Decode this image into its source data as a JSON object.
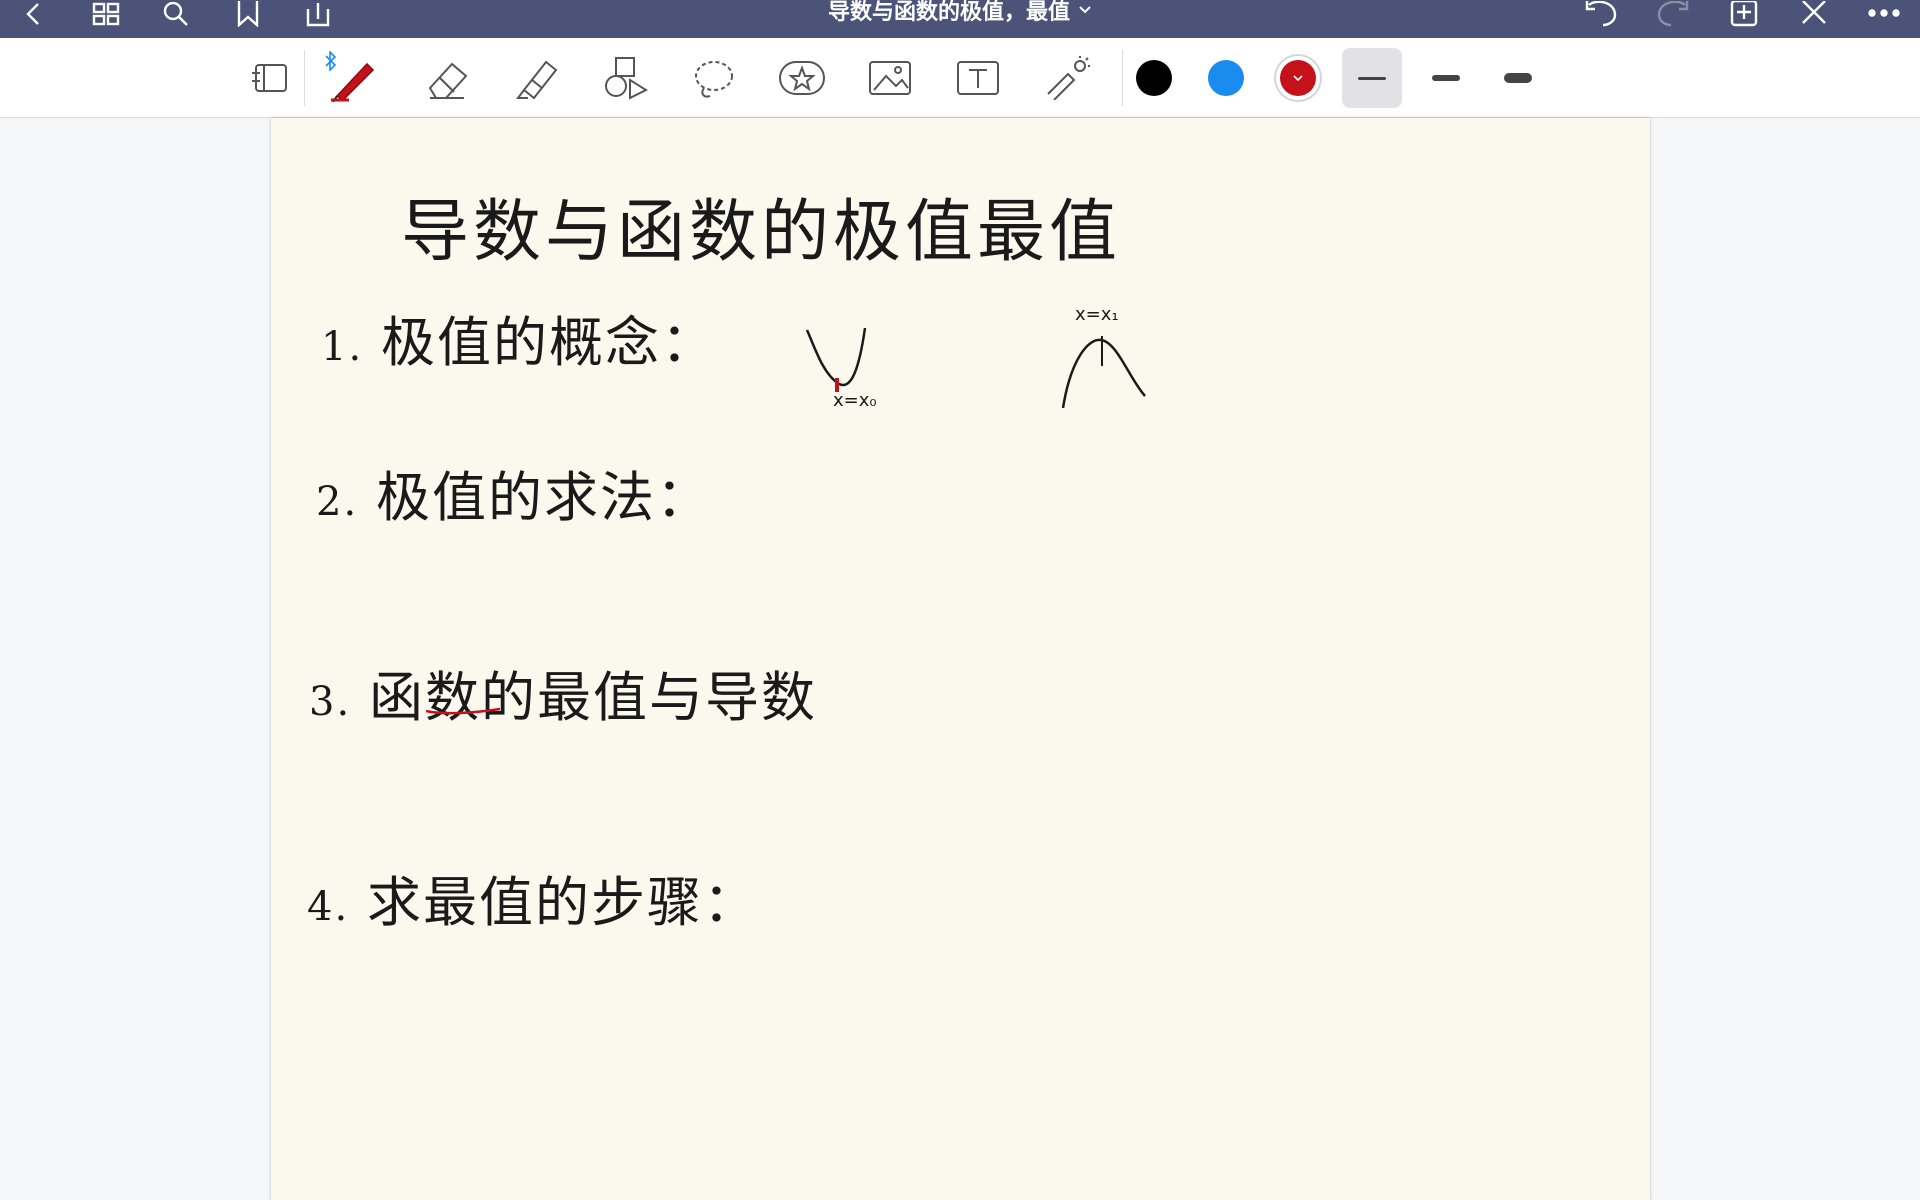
{
  "window": {
    "title": "导数与函数的极值，最值"
  },
  "toolbar": {
    "colors": [
      "#000000",
      "#1a8cf0",
      "#c4111a"
    ]
  },
  "note": {
    "title": "导数与函数的极值最值",
    "items": [
      {
        "num": "1.",
        "text": "极值的概念："
      },
      {
        "num": "2.",
        "text": "极值的求法："
      },
      {
        "num": "3.",
        "text": "函数的最值与导数"
      },
      {
        "num": "4.",
        "text": "求最值的步骤："
      }
    ],
    "sketch_labels": {
      "min": "x=x₀",
      "max": "x=x₁"
    }
  }
}
